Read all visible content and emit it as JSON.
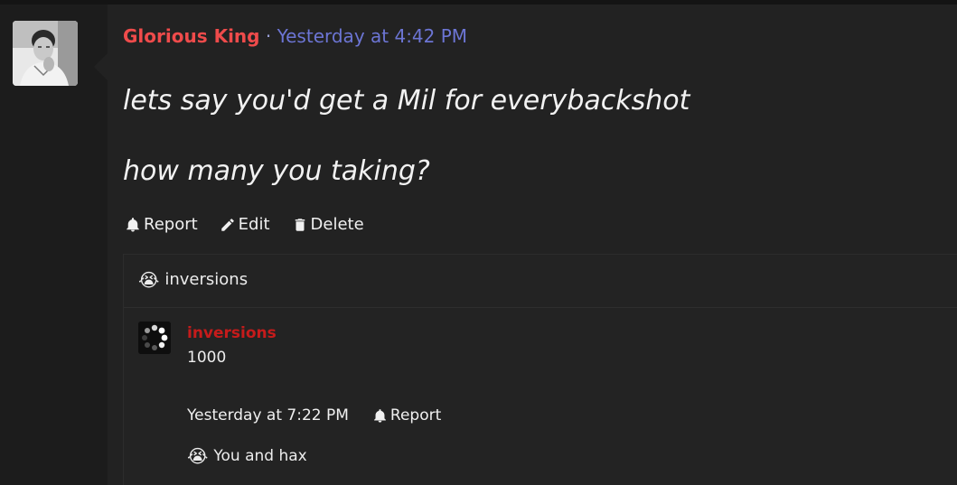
{
  "post": {
    "author": "Glorious King",
    "separator": "·",
    "timestamp": "Yesterday at 4:42 PM",
    "message_lines": [
      "lets say you'd get a Mil for everybackshot",
      "how many you taking?"
    ],
    "actions": {
      "report": "Report",
      "edit": "Edit",
      "delete": "Delete"
    }
  },
  "reactions": {
    "header_emoji": "😭",
    "header_user": "inversions"
  },
  "reply": {
    "author": "inversions",
    "text": "1000",
    "timestamp": "Yesterday at 7:22 PM",
    "report_label": "Report",
    "reaction_emoji": "😭",
    "reaction_text": "You and hax"
  },
  "colors": {
    "author": "#ef4b4b",
    "timestamp": "#6c75d4",
    "reply_author": "#c61b1b",
    "post_bg": "#222222"
  },
  "icons": [
    "bell-icon",
    "pencil-icon",
    "trash-icon",
    "loading-spinner-avatar"
  ]
}
